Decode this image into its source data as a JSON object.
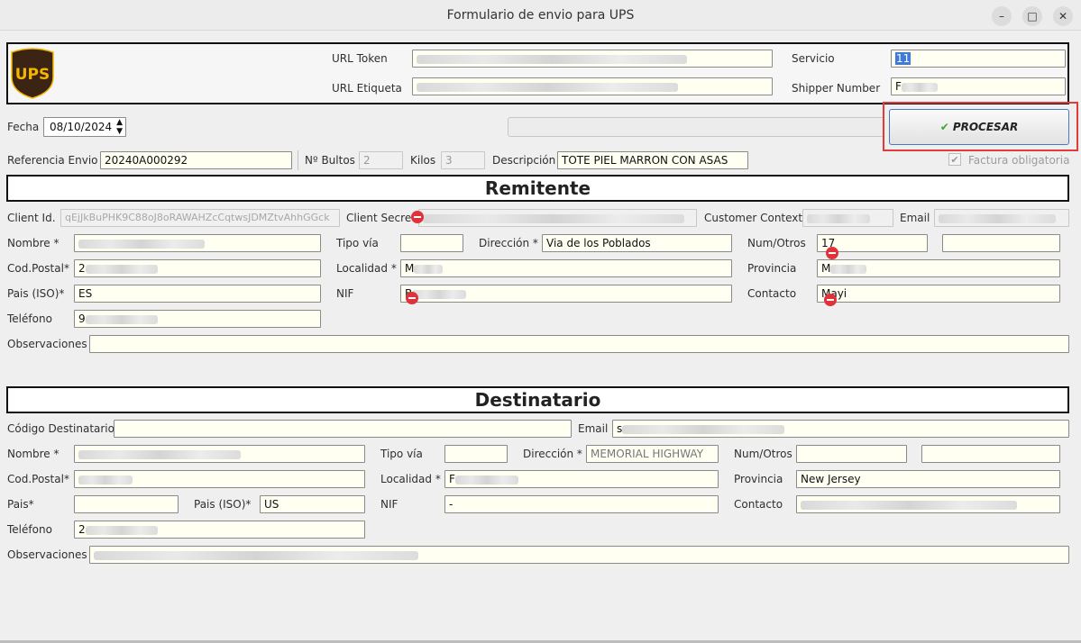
{
  "window": {
    "title": "Formulario de envio para UPS"
  },
  "header": {
    "logo_text": "UPS",
    "url_token_label": "URL Token",
    "url_token_value": "",
    "url_etiqueta_label": "URL Etiqueta",
    "url_etiqueta_value": "",
    "servicio_label": "Servicio",
    "servicio_value": "11",
    "shipper_label": "Shipper Number",
    "shipper_value": "F"
  },
  "controls": {
    "fecha_label": "Fecha",
    "fecha_value": "08/10/2024",
    "procesar_label": "PROCESAR",
    "referencia_label": "Referencia Envio",
    "referencia_value": "20240A000292",
    "bultos_label": "Nº Bultos",
    "bultos_value": "2",
    "kilos_label": "Kilos",
    "kilos_value": "3",
    "descripcion_label": "Descripción",
    "descripcion_value": "TOTE PIEL MARRON CON ASAS",
    "factura_label": "Factura obligatoria",
    "factura_checked": true
  },
  "remitente": {
    "title": "Remitente",
    "client_id_label": "Client Id.",
    "client_id_value": "qEjJkBuPHK9C88oJ8oRAWAHZcCqtwsJDMZtvAhhGGck",
    "client_secret_label": "Client Secret",
    "customer_context_label": "Customer Context",
    "email_label": "Email",
    "nombre_label": "Nombre *",
    "tipo_via_label": "Tipo vía",
    "direccion_label": "Dirección *",
    "direccion_value": "Via de los Poblados",
    "num_otros_label": "Num/Otros",
    "num_value": "17",
    "codpostal_label": "Cod.Postal*",
    "codpostal_value": "2",
    "localidad_label": "Localidad *",
    "localidad_value": "M",
    "provincia_label": "Provincia",
    "provincia_value": "M",
    "pais_iso_label": "Pais (ISO)*",
    "pais_iso_value": "ES",
    "nif_label": "NIF",
    "nif_value": "B",
    "contacto_label": "Contacto",
    "contacto_value": "Mayi",
    "telefono_label": "Teléfono",
    "telefono_value": "9",
    "observaciones_label": "Observaciones"
  },
  "destinatario": {
    "title": "Destinatario",
    "codigo_label": "Código Destinatario",
    "email_label": "Email",
    "email_value": "s",
    "nombre_label": "Nombre *",
    "tipo_via_label": "Tipo vía",
    "direccion_label": "Dirección *",
    "direccion_value": "MEMORIAL HIGHWAY",
    "num_otros_label": "Num/Otros",
    "codpostal_label": "Cod.Postal*",
    "localidad_label": "Localidad *",
    "localidad_value": "F",
    "provincia_label": "Provincia",
    "provincia_value": "New Jersey",
    "pais_label": "Pais*",
    "pais_iso_label": "Pais (ISO)*",
    "pais_iso_value": "US",
    "nif_label": "NIF",
    "nif_value": "-",
    "contacto_label": "Contacto",
    "telefono_label": "Teléfono",
    "telefono_value": "2",
    "observaciones_label": "Observaciones"
  },
  "colors": {
    "accent": "#2f5fb0",
    "highlight_border": "#e23b3b",
    "field_bg": "#fffff2",
    "ups_brown": "#3b2414",
    "ups_gold": "#f3b700"
  }
}
